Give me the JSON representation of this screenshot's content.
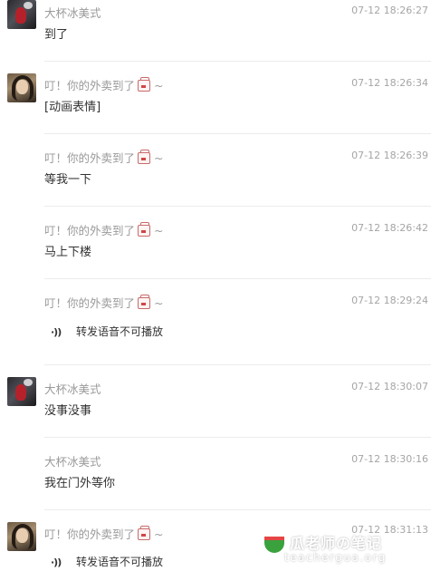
{
  "messages": [
    {
      "sender": "大杯冰美式",
      "time": "07-12 18:26:27",
      "text": "到了",
      "avatar": "iced-americano-avatar"
    },
    {
      "sender": "叮！你的外卖到了",
      "sender_tail": "~",
      "time": "07-12 18:26:34",
      "text": "[动画表情]",
      "avatar": "delivery-avatar"
    },
    {
      "sender": "叮！你的外卖到了",
      "sender_tail": "~",
      "time": "07-12 18:26:39",
      "text": "等我一下"
    },
    {
      "sender": "叮！你的外卖到了",
      "sender_tail": "~",
      "time": "07-12 18:26:42",
      "text": "马上下楼"
    },
    {
      "sender": "叮！你的外卖到了",
      "sender_tail": "~",
      "time": "07-12 18:29:24",
      "voice": "转发语音不可播放"
    },
    {
      "sender": "大杯冰美式",
      "time": "07-12 18:30:07",
      "text": "没事没事",
      "avatar": "iced-americano-avatar"
    },
    {
      "sender": "大杯冰美式",
      "time": "07-12 18:30:16",
      "text": "我在门外等你"
    },
    {
      "sender": "叮！你的外卖到了",
      "sender_tail": "~",
      "time": "07-12 18:31:13",
      "voice": "转发语音不可播放",
      "avatar": "delivery-avatar"
    }
  ],
  "watermark": {
    "title": "瓜老师の笔记",
    "url": "teachergua.org"
  },
  "icons": {
    "voice": "voice-wave-icon",
    "emoji": "takeout-cup-emoji-icon"
  }
}
